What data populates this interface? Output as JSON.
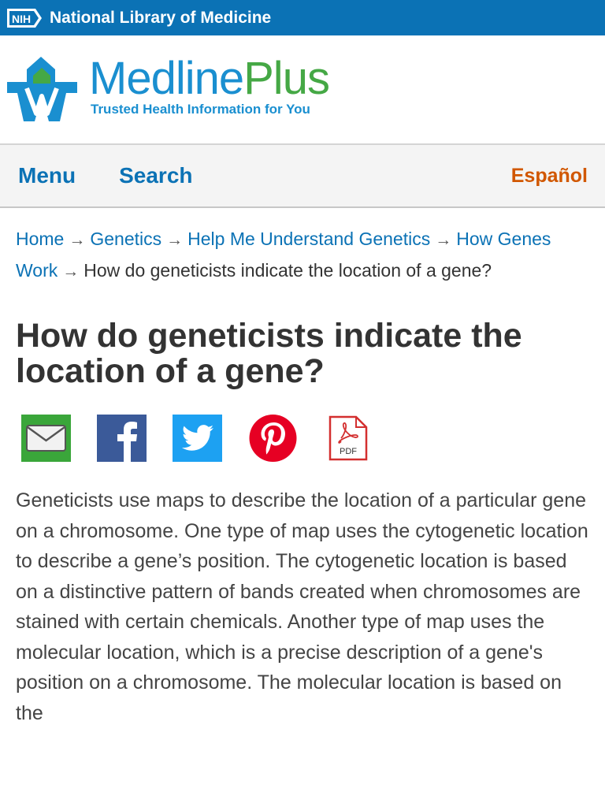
{
  "nih_bar": {
    "logo_text": "NIH",
    "title": "National Library of Medicine"
  },
  "brand": {
    "name_part1": "Medline",
    "name_part2": "Plus",
    "tagline": "Trusted Health Information for You"
  },
  "nav": {
    "menu_label": "Menu",
    "search_label": "Search",
    "language_label": "Español"
  },
  "breadcrumb": {
    "items": [
      "Home",
      "Genetics",
      "Help Me Understand Genetics",
      "How Genes Work"
    ],
    "current": "How do geneticists indicate the location of a gene?",
    "separator": "→"
  },
  "page_title": "How do geneticists indicate the location of a gene?",
  "share": {
    "pdf_label": "PDF"
  },
  "body_text": "Geneticists use maps to describe the location of a particular gene on a chromosome. One type of map uses the cytogenetic location to describe a gene’s position. The cytogenetic location is based on a distinctive pattern of bands created when chromosomes are stained with certain chemicals. Another type of map uses the molecular location, which is a precise description of a gene's position on a chromosome. The molecular location is based on the",
  "colors": {
    "nih_blue": "#0b72b5",
    "medline_blue": "#1a8fd0",
    "plus_green": "#45a845",
    "espanol_orange": "#d15700",
    "email_green": "#3aa63a",
    "facebook_blue": "#3b5a99",
    "twitter_blue": "#1da1f2",
    "pinterest_red": "#e60023",
    "pdf_red": "#d32f2f"
  }
}
